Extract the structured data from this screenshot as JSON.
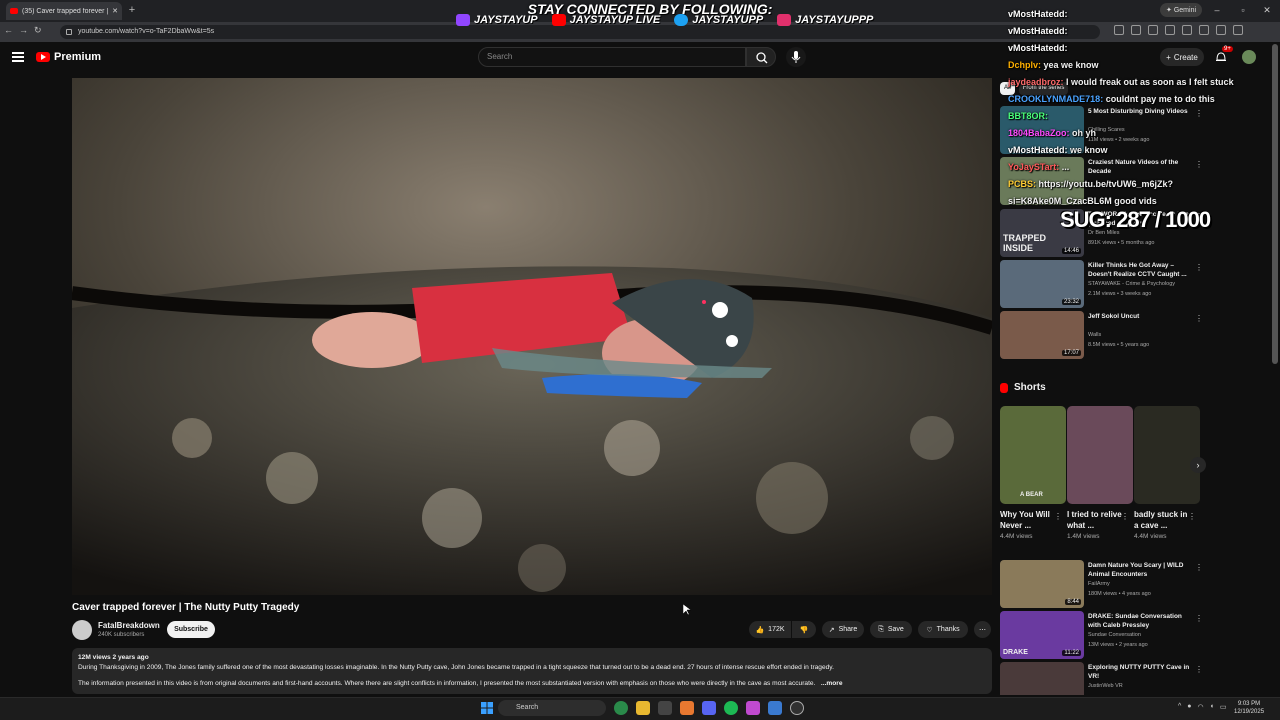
{
  "browser": {
    "tab_title": "(35) Caver trapped forever | The",
    "url": "youtube.com/watch?v=o-TaF2DbaWw&t=5s",
    "gemini_label": "Gemini"
  },
  "overlay": {
    "title": "STAY CONNECTED BY FOLLOWING:",
    "socials": [
      {
        "platform_icon": "twitch-icon",
        "handle": "JAYSTAYUP",
        "color": "#9146ff"
      },
      {
        "platform_icon": "youtube-icon",
        "handle": "JAYSTAYUP LIVE",
        "color": "#ff0000"
      },
      {
        "platform_icon": "twitter-icon",
        "handle": "JAYSTAYUPP",
        "color": "#1da1f2"
      },
      {
        "platform_icon": "instagram-icon",
        "handle": "JAYSTAYUPPP",
        "color": "#e1306c"
      }
    ]
  },
  "header": {
    "logo_text": "Premium",
    "search_placeholder": "Search",
    "create_label": "Create",
    "notif_count": "9+"
  },
  "video": {
    "title": "Caver trapped forever | The Nutty Putty Tragedy",
    "channel": "FatalBreakdown",
    "subscribers": "240K subscribers",
    "subscribe_label": "Subscribe",
    "likes": "172K",
    "share_label": "Share",
    "save_label": "Save",
    "thanks_label": "Thanks",
    "views_date": "12M views  2 years ago",
    "description_1": "During Thanksgiving in 2009, The Jones family suffered one of the most devastating losses imaginable. In the Nutty Putty cave, John Jones became trapped in a tight squeeze that turned out to be a dead end. 27 hours of intense rescue effort ended in tragedy.",
    "description_2": "The information presented in this video is from original documents and first-hand accounts. Where there are slight conflicts in information, I presented the most substantiated version with emphasis on those who were directly in the cave as most accurate.",
    "more_label": "...more"
  },
  "chips": [
    "All",
    "From the series"
  ],
  "recommendations": [
    {
      "title": "5 Most Disturbing Diving Videos",
      "channel": "Chilling Scares",
      "views": "11M views • 2 weeks ago",
      "duration": "",
      "color": "#2a5a6a"
    },
    {
      "title": "Craziest Nature Videos of the Decade",
      "channel": "",
      "views": "",
      "duration": "",
      "color": "#6a7a5a"
    },
    {
      "title": "The WORST Cave Accidents Ever (Trapped & Dying)",
      "channel": "Dr Ben Miles",
      "views": "891K views • 5 months ago",
      "duration": "14:46",
      "color": "#3a3a44"
    },
    {
      "title": "Killer Thinks He Got Away – Doesn't Realize CCTV Caught ...",
      "channel": "STAYAWAKE - Crime & Psychology",
      "views": "2.1M views • 3 weeks ago",
      "duration": "23:32",
      "color": "#5a6a7a"
    },
    {
      "title": "Jeff Sokol Uncut",
      "channel": "Walls",
      "views": "8.5M views • 5 years ago",
      "duration": "17:07",
      "color": "#7a5a4a"
    }
  ],
  "thumb_text": {
    "trapped": "TRAPPED INSIDE"
  },
  "shorts": {
    "heading": "Shorts",
    "items": [
      {
        "title": "Why You Will Never ...",
        "views": "4.4M views",
        "badge": "A BEAR",
        "color": "#5a6a3a"
      },
      {
        "title": "I tried to relive what ...",
        "views": "1.4M views",
        "badge": "",
        "color": "#6a4a5a"
      },
      {
        "title": "badly stuck in a cave ...",
        "views": "4.4M views",
        "badge": "",
        "color": "#2a2a22"
      }
    ]
  },
  "recommendations_2": [
    {
      "title": "Damn Nature You Scary | WILD Animal Encounters",
      "channel": "FailArmy",
      "views": "180M views • 4 years ago",
      "duration": "8:44",
      "color": "#8a7a5a"
    },
    {
      "title": "DRAKE: Sundae Conversation with Caleb Pressley",
      "channel": "Sundae Conversation",
      "views": "13M views • 2 years ago",
      "duration": "11:22",
      "color": "#6a3aa0",
      "badge": "DRAKE"
    },
    {
      "title": "Exploring NUTTY PUTTY Cave in VR!",
      "channel": "JustinWeb VR",
      "views": "",
      "duration": "",
      "color": "#4a3a3a"
    }
  ],
  "chat": [
    {
      "user": "vMostHatedd:",
      "text": "",
      "color": "#ffffff"
    },
    {
      "user": "vMostHatedd:",
      "text": "",
      "color": "#ffffff"
    },
    {
      "user": "vMostHatedd:",
      "text": "",
      "color": "#ffffff"
    },
    {
      "user": "Dchplv:",
      "text": "yea we know",
      "color": "#ffb000"
    },
    {
      "user": "jaydeadbroz:",
      "text": "I would freak out as soon as I felt stuck",
      "color": "#ff6a6a"
    },
    {
      "user": "CROOKLYNMADE718:",
      "text": "couldnt pay me to do this",
      "color": "#4aa3ff"
    },
    {
      "user": "BBT8OR:",
      "text": "",
      "color": "#4aff7a"
    },
    {
      "user": "1804BabaZoo:",
      "text": "oh yh",
      "color": "#ff4aff"
    },
    {
      "user": "vMostHatedd:",
      "text": "we know",
      "color": "#ffffff"
    },
    {
      "user": "YoJaySTart:",
      "text": "...",
      "color": "#ff5a5a"
    },
    {
      "user": "PCBS:",
      "text": "https://youtu.be/tvUW6_m6jZk?",
      "color": "#ffcc33"
    },
    {
      "user": "",
      "text": "si=K8Ake0M_CzacBL6M good vids",
      "color": "#ffffff"
    }
  ],
  "sug_counter": "SUG: 287 / 1000",
  "taskbar": {
    "search": "Search",
    "time": "9:03 PM",
    "date": "12/19/2025"
  },
  "colors": {
    "accent": "#ff0000",
    "bg": "#0f0f0f"
  }
}
